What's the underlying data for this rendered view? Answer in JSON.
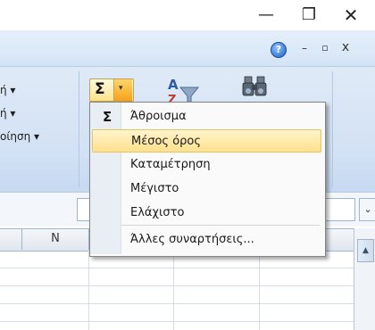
{
  "window": {
    "minimize_glyph": "—",
    "restore_glyph": "❐",
    "close_glyph": "✕"
  },
  "ribbon": {
    "help_glyph": "?",
    "minimize_glyph": "–",
    "restore_glyph": "▫",
    "close_glyph": "x",
    "left_items": [
      "ή ▾",
      "ή ▾",
      "οίηση ▾"
    ],
    "autosum_glyph": "Σ",
    "autosum_arrow_glyph": "▾",
    "sort_icon": "sort-filter-icon",
    "find_icon": "find-select-binoculars-icon"
  },
  "grid": {
    "column_header": "N",
    "formula_expand_glyph": "⌄",
    "scroll_up_glyph": "▲"
  },
  "autosum_menu": {
    "sigma_glyph": "Σ",
    "items": [
      {
        "label": "Άθροισμα",
        "selected": false
      },
      {
        "label": "Μέσος όρος",
        "selected": true
      },
      {
        "label": "Καταμέτρηση",
        "selected": false
      },
      {
        "label": "Μέγιστο",
        "selected": false
      },
      {
        "label": "Ελάχιστο",
        "selected": false
      }
    ],
    "more_functions": "Άλλες συναρτήσεις..."
  },
  "colors": {
    "ribbon_bg": "#d4e4f6",
    "menu_highlight": "#ffe08c",
    "autosum_arrow": "#f7a11b"
  }
}
